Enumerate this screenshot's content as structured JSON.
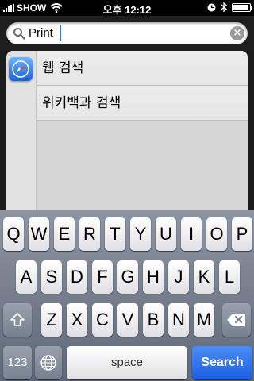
{
  "status_bar": {
    "carrier": "SHOW",
    "time": "오후 12:12",
    "icons": [
      "signal-icon",
      "wifi-icon",
      "clock-icon",
      "bluetooth-icon",
      "battery-icon"
    ],
    "battery_level": 0.9
  },
  "search": {
    "query": "Print",
    "clear_icon": "clear-icon",
    "search_icon": "magnifier-icon"
  },
  "results": {
    "app_icon": "safari-icon",
    "items": [
      {
        "label": "웹 검색"
      },
      {
        "label": "위키백과 검색"
      }
    ]
  },
  "keyboard": {
    "row1": [
      "Q",
      "W",
      "E",
      "R",
      "T",
      "Y",
      "U",
      "I",
      "O",
      "P"
    ],
    "row2": [
      "A",
      "S",
      "D",
      "F",
      "G",
      "H",
      "J",
      "K",
      "L"
    ],
    "row3": [
      "Z",
      "X",
      "C",
      "V",
      "B",
      "N",
      "M"
    ],
    "shift_icon": "shift-icon",
    "delete_icon": "delete-icon",
    "globe_icon": "globe-icon",
    "numbers_label": "123",
    "space_label": "space",
    "search_label": "Search"
  },
  "colors": {
    "accent": "#1c5fe0",
    "caret": "#3c7be8"
  }
}
